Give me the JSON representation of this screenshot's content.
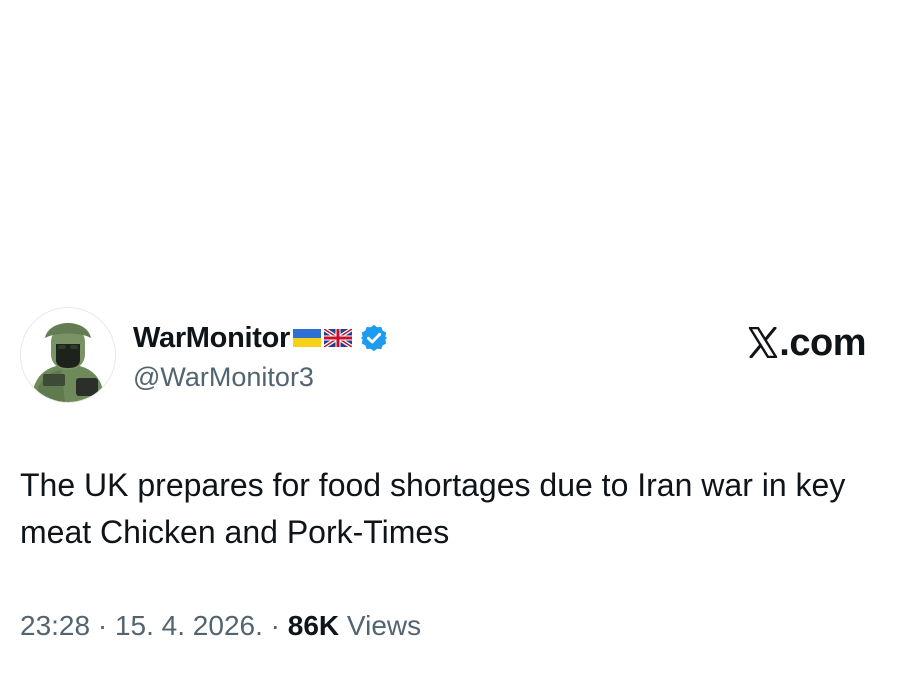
{
  "author": {
    "display_name": "WarMonitor",
    "handle": "@WarMonitor3",
    "verified": true,
    "flags": [
      "flag-ukraine-icon",
      "flag-uk-icon"
    ],
    "avatar": "soldier-avatar"
  },
  "brand": {
    "label": ".com",
    "logo": "x-logo-icon"
  },
  "tweet": {
    "text": "The UK prepares for food shortages due to Iran war in key meat Chicken and Pork-Times"
  },
  "meta": {
    "time": "23:28",
    "date": "15. 4. 2026.",
    "separator": "·",
    "views_count": "86K",
    "views_label": "Views"
  },
  "colors": {
    "text": "#0f1419",
    "secondary": "#536471",
    "verified": "#1d9bf0",
    "background": "#ffffff"
  }
}
